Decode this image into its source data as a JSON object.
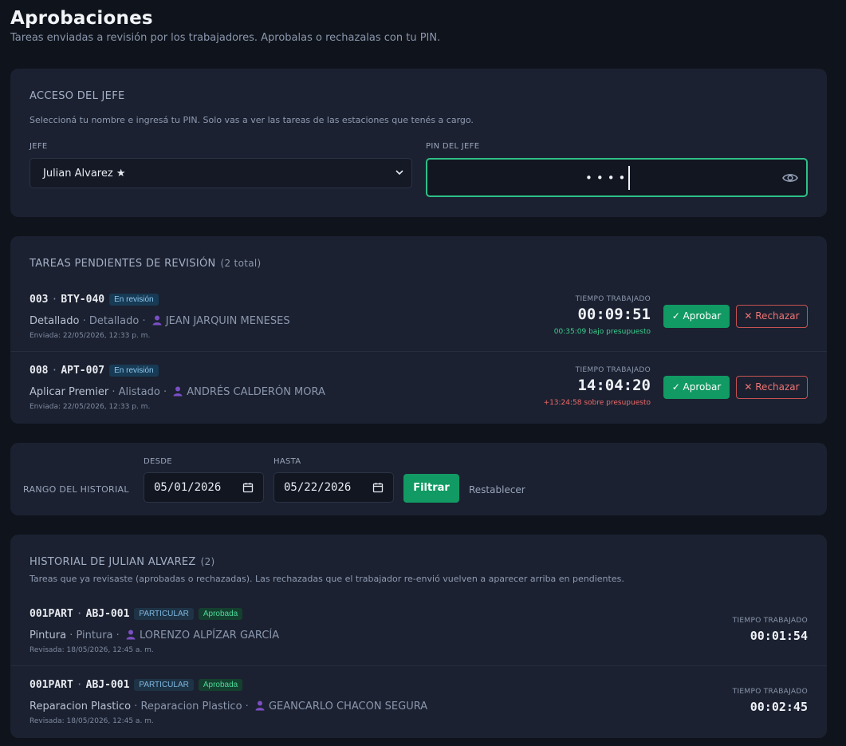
{
  "page": {
    "title": "Aprobaciones",
    "subtitle": "Tareas enviadas a revisión por los trabajadores. Aprobalas o rechazalas con tu PIN."
  },
  "access": {
    "title": "ACCESO DEL JEFE",
    "description": "Seleccioná tu nombre e ingresá tu PIN. Solo vas a ver las tareas de las estaciones que tenés a cargo.",
    "boss_label": "JEFE",
    "boss_value": "Julian Alvarez ★",
    "pin_label": "PIN DEL JEFE",
    "pin_masked": "••••"
  },
  "pending": {
    "title": "TAREAS PENDIENTES DE REVISIÓN",
    "count": "(2 total)",
    "time_label": "TIEMPO TRABAJADO",
    "approve_label": "✓ Aprobar",
    "reject_label": "✕ Rechazar",
    "tasks": [
      {
        "order": "003",
        "vehicle": "BTY-040",
        "status": "En revisión",
        "task": "Detallado",
        "station": "Detallado",
        "worker": "JEAN JARQUIN MENESES",
        "sent": "Enviada: 22/05/2026, 12:33 p. m.",
        "time": "00:09:51",
        "budget": "00:35:09 bajo presupuesto",
        "budget_status": "under"
      },
      {
        "order": "008",
        "vehicle": "APT-007",
        "status": "En revisión",
        "task": "Aplicar Premier",
        "station": "Alistado",
        "worker": "ANDRÉS CALDERÓN MORA",
        "sent": "Enviada: 22/05/2026, 12:33 p. m.",
        "time": "14:04:20",
        "budget": "+13:24:58 sobre presupuesto",
        "budget_status": "over"
      }
    ]
  },
  "range": {
    "label": "RANGO DEL HISTORIAL",
    "from_label": "DESDE",
    "from_value": "05/01/2026",
    "to_label": "HASTA",
    "to_value": "05/22/2026",
    "filter_label": "Filtrar",
    "reset_label": "Restablecer"
  },
  "history": {
    "title": "HISTORIAL DE JULIAN ALVAREZ",
    "count": "(2)",
    "description": "Tareas que ya revisaste (aprobadas o rechazadas). Las rechazadas que el trabajador re-envió vuelven a aparecer arriba en pendientes.",
    "time_label": "TIEMPO TRABAJADO",
    "items": [
      {
        "order": "001PART",
        "vehicle": "ABJ-001",
        "type_badge": "PARTICULAR",
        "status": "Aprobada",
        "task": "Pintura",
        "station": "Pintura",
        "worker": "LORENZO ALPÍZAR GARCÍA",
        "reviewed": "Revisada: 18/05/2026, 12:45 a. m.",
        "time": "00:01:54"
      },
      {
        "order": "001PART",
        "vehicle": "ABJ-001",
        "type_badge": "PARTICULAR",
        "status": "Aprobada",
        "task": "Reparacion Plastico",
        "station": "Reparacion Plastico",
        "worker": "GEANCARLO CHACON SEGURA",
        "reviewed": "Revisada: 18/05/2026, 12:45 a. m.",
        "time": "00:02:45"
      }
    ]
  },
  "colors": {
    "accent_green": "#119a63",
    "focus_green": "#2fbf86",
    "reject_red": "#c65252",
    "background": "#0f131b",
    "card": "#1b2130"
  }
}
